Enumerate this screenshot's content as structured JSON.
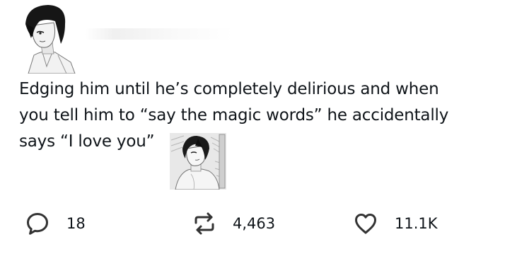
{
  "tweet": {
    "text": "Edging him until he’s completely delirious and when\nyou tell him to “say the magic words” he accidentally\nsays “I love you”"
  },
  "actions": {
    "reply": {
      "icon": "speech-bubble-icon",
      "count": "18"
    },
    "retweet": {
      "icon": "retweet-icon",
      "count": "4,463"
    },
    "like": {
      "icon": "heart-icon",
      "count": "11.1K"
    }
  },
  "colors": {
    "text": "#0f1419",
    "icon": "#333333",
    "background": "#ffffff"
  }
}
